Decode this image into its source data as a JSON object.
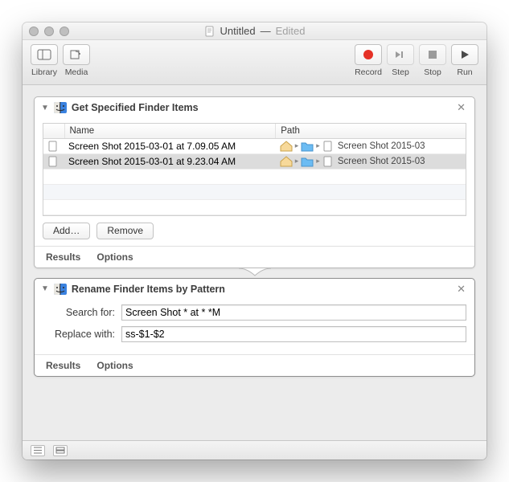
{
  "window": {
    "title": "Untitled",
    "status": "Edited"
  },
  "toolbar": {
    "library": "Library",
    "media": "Media",
    "record": "Record",
    "step": "Step",
    "stop": "Stop",
    "run": "Run"
  },
  "action1": {
    "title": "Get Specified Finder Items",
    "columns": {
      "name": "Name",
      "path": "Path"
    },
    "rows": [
      {
        "name": "Screen Shot 2015-03-01 at 7.09.05 AM",
        "path_tail": "Screen Shot 2015-03"
      },
      {
        "name": "Screen Shot 2015-03-01 at 9.23.04 AM",
        "path_tail": "Screen Shot 2015-03"
      }
    ],
    "add_label": "Add…",
    "remove_label": "Remove",
    "results_label": "Results",
    "options_label": "Options"
  },
  "action2": {
    "title": "Rename Finder Items by Pattern",
    "search_label": "Search for:",
    "search_value": "Screen Shot * at * *M",
    "replace_label": "Replace with:",
    "replace_value": "ss-$1-$2",
    "results_label": "Results",
    "options_label": "Options"
  }
}
